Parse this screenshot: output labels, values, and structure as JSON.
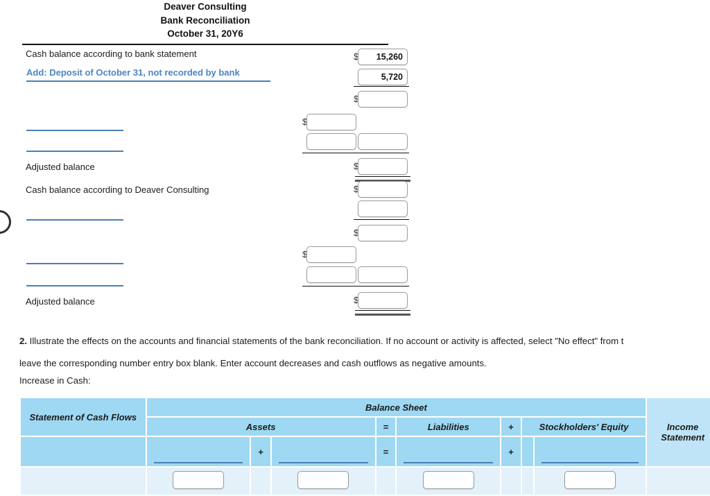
{
  "statement": {
    "company": "Deaver Consulting",
    "doc_title": "Bank Reconciliation",
    "date": "October 31, 20Y6",
    "rows": {
      "bank_balance_label": "Cash balance according to bank statement",
      "bank_balance_value": "15,260",
      "add_deposit_label": "Add: Deposit of October 31, not recorded by bank",
      "add_deposit_value": "5,720",
      "adjusted_balance_label": "Adjusted balance",
      "company_balance_label": "Cash balance according to Deaver Consulting",
      "adjusted_balance_label_2": "Adjusted balance"
    },
    "currency_symbol": "$"
  },
  "question2": {
    "number": "2.",
    "line1": "Illustrate the effects on the accounts and financial statements of the bank reconciliation. If no account or activity is affected, select \"No effect\" from t",
    "line2": "leave the corresponding number entry box blank. Enter account decreases and cash outflows as negative amounts.",
    "increase_label": "Increase in Cash:"
  },
  "effects_table": {
    "statement_of_cash_flows": "Statement of Cash Flows",
    "balance_sheet": "Balance Sheet",
    "assets": "Assets",
    "equals": "=",
    "liabilities": "Liabilities",
    "plus": "+",
    "stockholders_equity": "Stockholders' Equity",
    "income_statement": "Income Statement"
  },
  "colors": {
    "select_blue": "#4a86c4",
    "underline_blue": "#4a7fb5",
    "table_header_blue": "#9ed8f2",
    "table_soft_blue": "#bfe4f7",
    "table_entry_blue": "#e2f1fa"
  }
}
